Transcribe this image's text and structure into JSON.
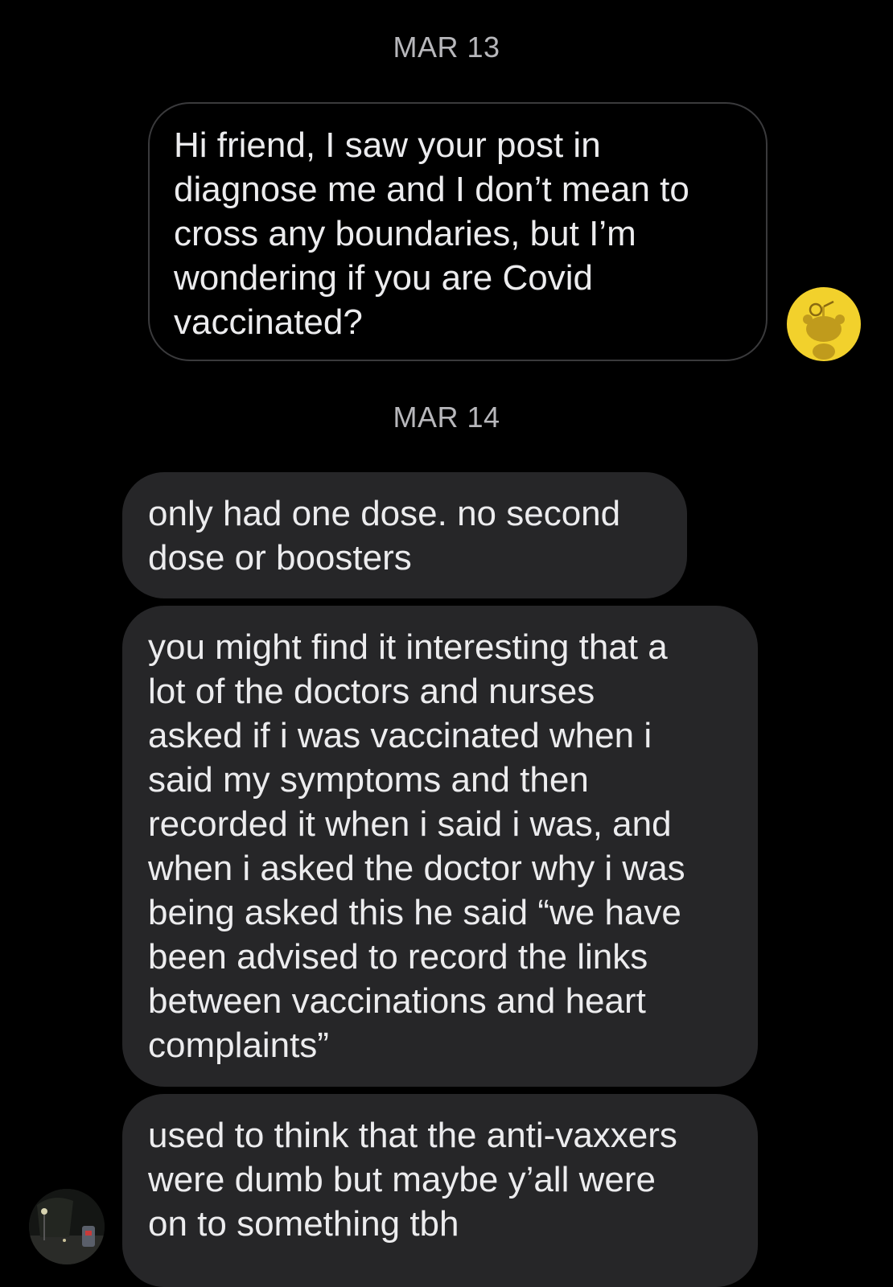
{
  "conversation": {
    "dates": {
      "first": "MAR 13",
      "second": "MAR 14"
    },
    "messages": [
      {
        "sender": "self",
        "text": "Hi friend, I saw your post in\ndiagnose me  and I don’t mean to\ncross any boundaries, but I’m\nwondering if you are Covid\nvaccinated?"
      },
      {
        "sender": "other",
        "text": "only had one dose. no second\ndose or boosters"
      },
      {
        "sender": "other",
        "text": "you might find it interesting that a\nlot of the doctors and nurses\nasked if i was vaccinated when i\nsaid my symptoms and then\nrecorded it when i said i was, and\nwhen i asked the doctor why i was\nbeing asked this he said “we have\nbeen advised to record the links\nbetween vaccinations and heart\ncomplaints”"
      },
      {
        "sender": "other",
        "text": "used to think that the anti-vaxxers\nwere dumb but maybe y’all were\non to something tbh"
      }
    ]
  },
  "avatars": {
    "self": {
      "icon": "reddit-snoo-icon",
      "color": "#f2d12c"
    },
    "other": {
      "icon": "night-street-photo"
    }
  },
  "colors": {
    "background": "#000000",
    "incoming_bubble": "#262628",
    "outgoing_border": "#3a3a3c",
    "date_text": "#b7b7bb",
    "message_text": "#ececee"
  }
}
